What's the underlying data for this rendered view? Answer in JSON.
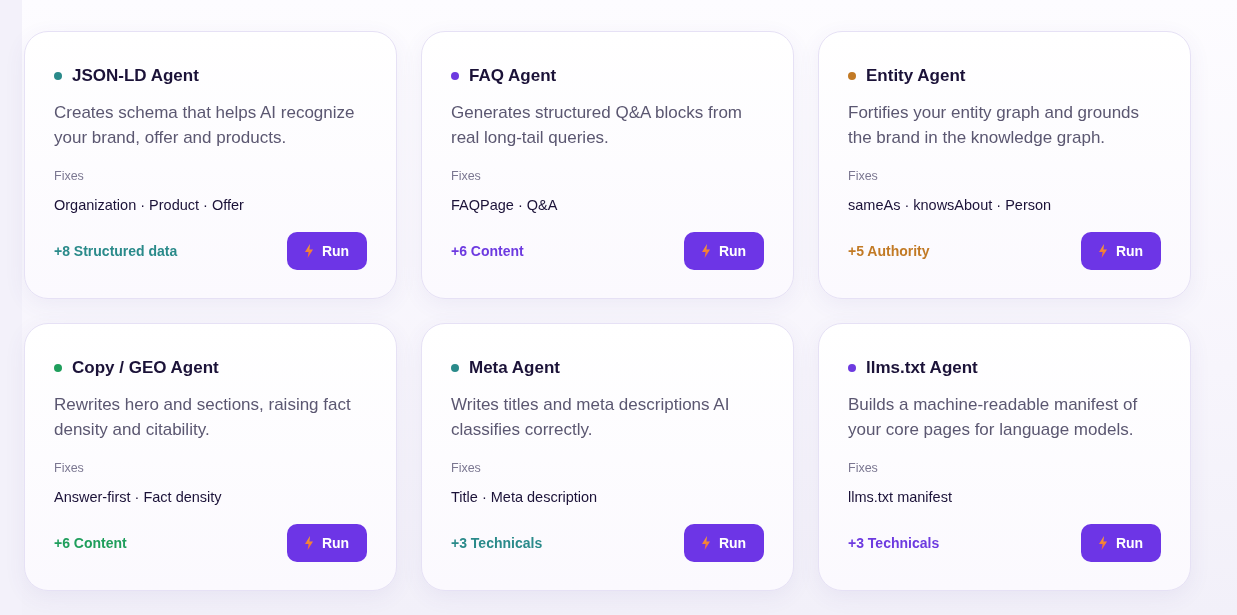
{
  "agents": [
    {
      "name": "JSON-LD Agent",
      "color": "#2a8a8a",
      "description": "Creates schema that helps AI recognize your brand, offer and products.",
      "fixes_label": "Fixes",
      "fixes": "Organization · Product · Offer",
      "impact": "+8 Structured data",
      "button": "Run"
    },
    {
      "name": "FAQ Agent",
      "color": "#6d3ae0",
      "description": "Generates structured Q&A blocks from real long-tail queries.",
      "fixes_label": "Fixes",
      "fixes": "FAQPage · Q&A",
      "impact": "+6 Content",
      "button": "Run"
    },
    {
      "name": "Entity Agent",
      "color": "#c27a25",
      "description": "Fortifies your entity graph and grounds the brand in the knowledge graph.",
      "fixes_label": "Fixes",
      "fixes": "sameAs · knowsAbout · Person",
      "impact": "+5 Authority",
      "button": "Run"
    },
    {
      "name": "Copy / GEO Agent",
      "color": "#1f9e5c",
      "description": "Rewrites hero and sections, raising fact density and citability.",
      "fixes_label": "Fixes",
      "fixes": "Answer-first · Fact density",
      "impact": "+6 Content",
      "button": "Run"
    },
    {
      "name": "Meta Agent",
      "color": "#2a8a8a",
      "description": "Writes titles and meta descriptions AI classifies correctly.",
      "fixes_label": "Fixes",
      "fixes": "Title · Meta description",
      "impact": "+3 Technicals",
      "button": "Run"
    },
    {
      "name": "llms.txt Agent",
      "color": "#6d3ae0",
      "description": "Builds a machine-readable manifest of your core pages for language models.",
      "fixes_label": "Fixes",
      "fixes": "llms.txt manifest",
      "impact": "+3 Technicals",
      "button": "Run"
    }
  ]
}
